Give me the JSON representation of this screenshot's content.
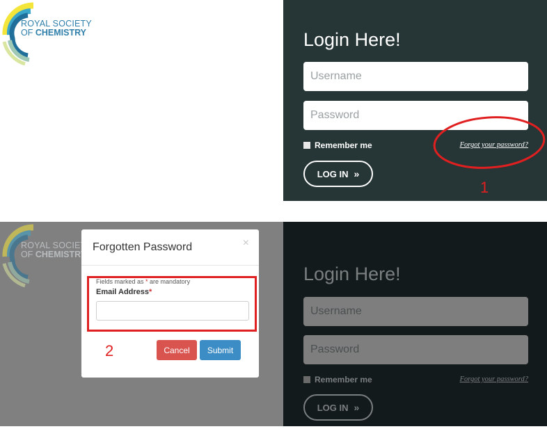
{
  "logo": {
    "line1": "ROYAL SOCIETY",
    "line2_prefix": "OF ",
    "line2_bold": "CHEMISTRY"
  },
  "login_panel": {
    "title": "Login Here!",
    "username_placeholder": "Username",
    "password_placeholder": "Password",
    "remember_label": "Remember me",
    "forgot_link": "Forgot your password?",
    "login_button": "LOG IN",
    "login_chevron": "»"
  },
  "modal": {
    "title": "Forgotten Password",
    "close": "×",
    "mandatory_prefix": "Fields marked as ",
    "mandatory_star": "*",
    "mandatory_suffix": " are mandatory",
    "email_label": "Email Address",
    "email_required_star": "*",
    "email_value": "",
    "cancel_button": "Cancel",
    "submit_button": "Submit"
  },
  "annotations": {
    "step1": "1",
    "step2": "2",
    "color": "#e02020"
  },
  "colors": {
    "panel_top": "#263536",
    "panel_bottom": "#131a1b",
    "overlay": "#808080",
    "cancel": "#d9534f",
    "submit": "#3c8dc5"
  }
}
